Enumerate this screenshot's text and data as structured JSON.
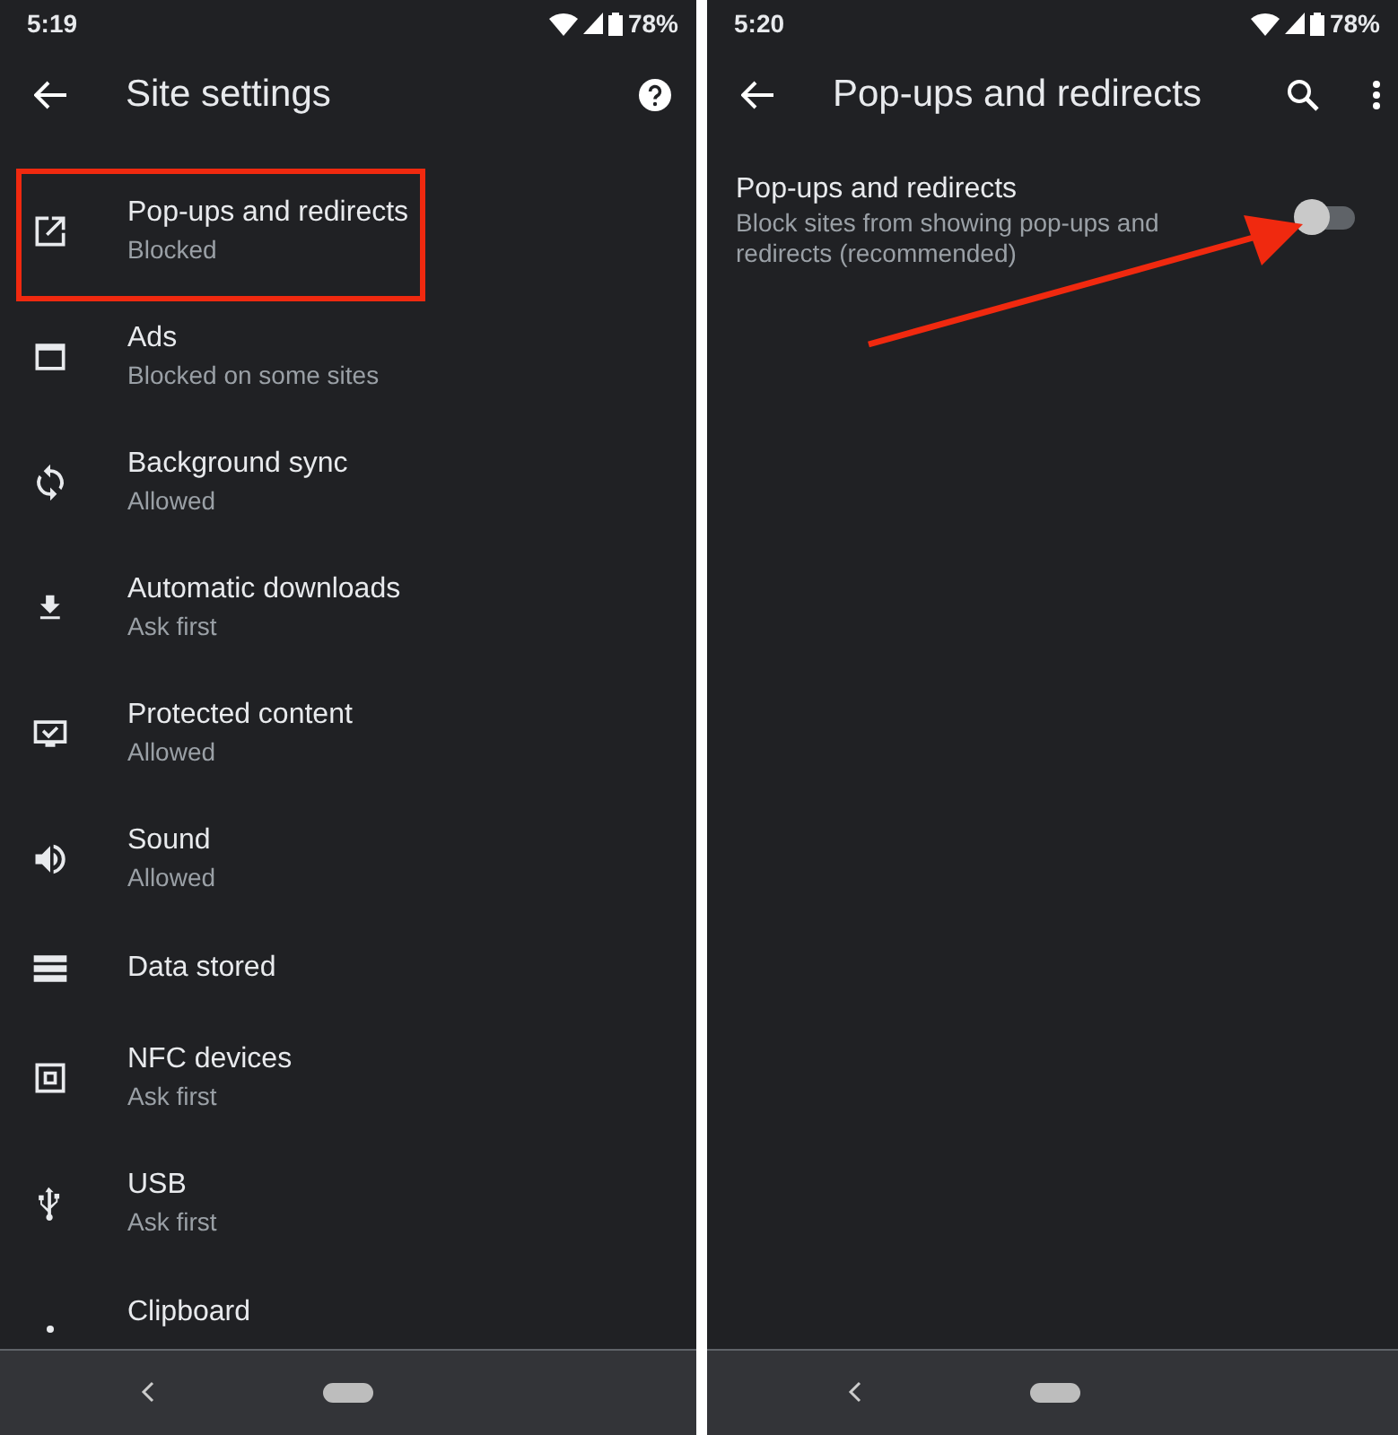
{
  "left_screen": {
    "status_bar": {
      "time": "5:19",
      "battery": "78%"
    },
    "app_bar": {
      "title": "Site settings"
    },
    "items": [
      {
        "title": "Pop-ups and redirects",
        "subtitle": "Blocked",
        "highlighted": true
      },
      {
        "title": "Ads",
        "subtitle": "Blocked on some sites",
        "highlighted": false
      },
      {
        "title": "Background sync",
        "subtitle": "Allowed",
        "highlighted": false
      },
      {
        "title": "Automatic downloads",
        "subtitle": "Ask first",
        "highlighted": false
      },
      {
        "title": "Protected content",
        "subtitle": "Allowed",
        "highlighted": false
      },
      {
        "title": "Sound",
        "subtitle": "Allowed",
        "highlighted": false
      },
      {
        "title": "Data stored",
        "highlighted": false
      },
      {
        "title": "NFC devices",
        "subtitle": "Ask first",
        "highlighted": false
      },
      {
        "title": "USB",
        "subtitle": "Ask first",
        "highlighted": false
      },
      {
        "title": "Clipboard",
        "highlighted": false
      }
    ]
  },
  "right_screen": {
    "status_bar": {
      "time": "5:20",
      "battery": "78%"
    },
    "app_bar": {
      "title": "Pop-ups and redirects"
    },
    "setting": {
      "title": "Pop-ups and redirects",
      "description": "Block sites from showing pop-ups and redirects (recommended)",
      "on": false
    }
  }
}
